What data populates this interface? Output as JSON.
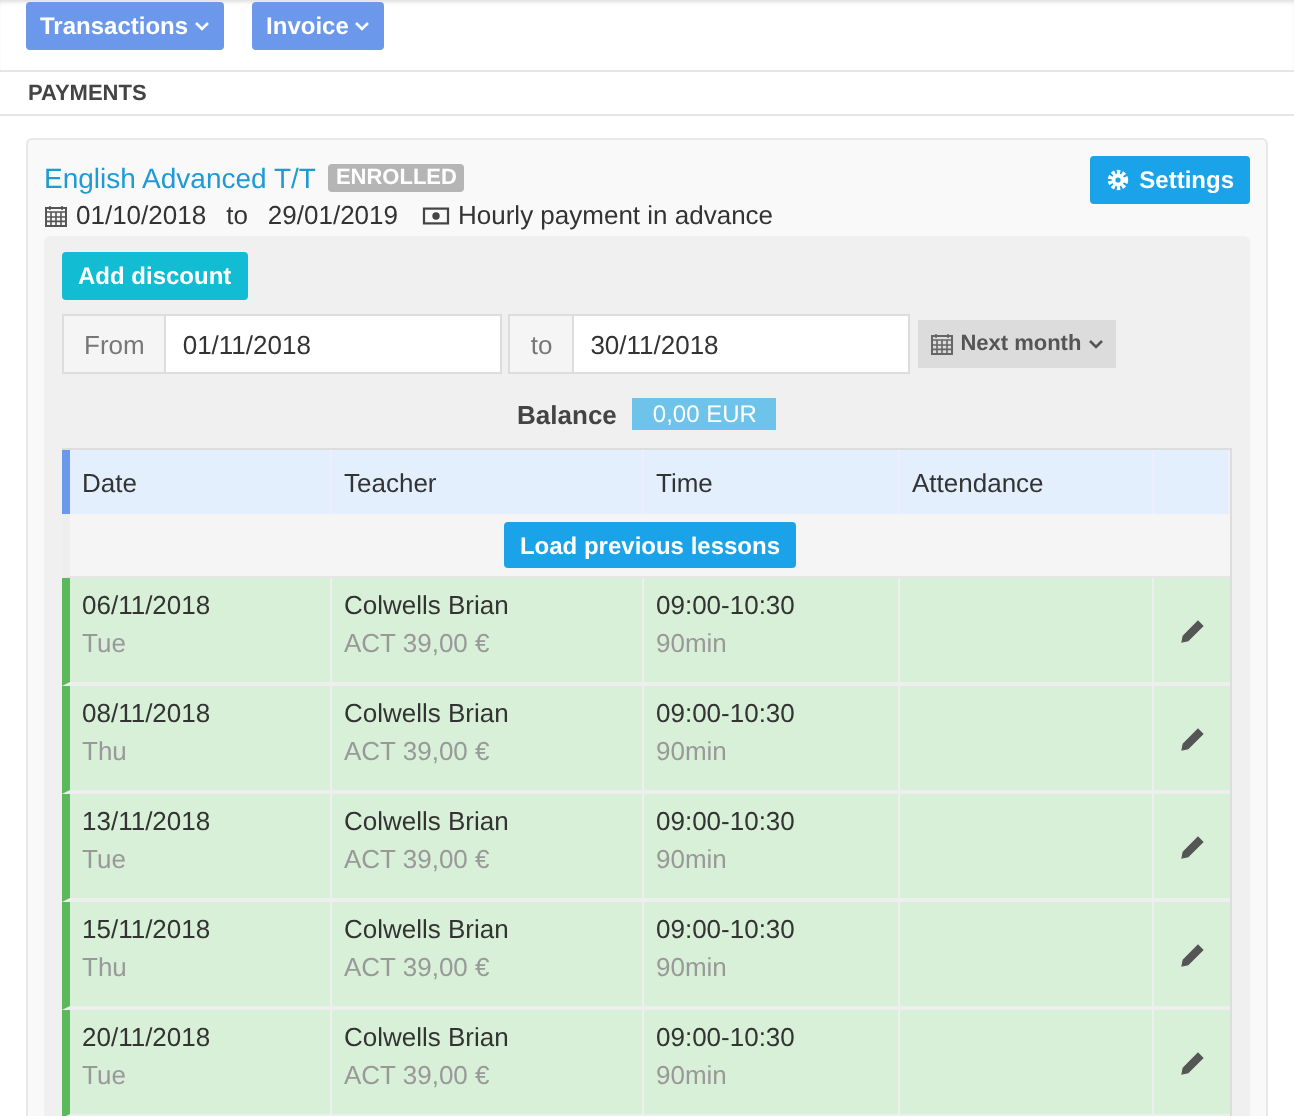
{
  "toolbar": {
    "buttons": [
      {
        "label": "Transactions"
      },
      {
        "label": "Invoice"
      }
    ]
  },
  "section_title": "PAYMENTS",
  "course": {
    "name": "English Advanced T/T",
    "badge": "ENROLLED",
    "start": "01/10/2018",
    "separator": "to",
    "end": "29/01/2019",
    "payment": "Hourly payment in advance",
    "settings_button": "Settings"
  },
  "add_discount_button": "Add discount",
  "range": {
    "from_label": "From",
    "from_value": "01/11/2018",
    "to_label": "to",
    "to_value": "30/11/2018",
    "preset_button": "Next month"
  },
  "balance": {
    "label": "Balance",
    "value": "0,00 EUR"
  },
  "table": {
    "columns": [
      "Date",
      "Teacher",
      "Time",
      "Attendance"
    ],
    "load_button": "Load previous lessons",
    "rows": [
      {
        "date": "06/11/2018",
        "day": "Tue",
        "teacher": "Colwells Brian",
        "price": "ACT 39,00 €",
        "time": "09:00-10:30",
        "duration": "90min"
      },
      {
        "date": "08/11/2018",
        "day": "Thu",
        "teacher": "Colwells Brian",
        "price": "ACT 39,00 €",
        "time": "09:00-10:30",
        "duration": "90min"
      },
      {
        "date": "13/11/2018",
        "day": "Tue",
        "teacher": "Colwells Brian",
        "price": "ACT 39,00 €",
        "time": "09:00-10:30",
        "duration": "90min"
      },
      {
        "date": "15/11/2018",
        "day": "Thu",
        "teacher": "Colwells Brian",
        "price": "ACT 39,00 €",
        "time": "09:00-10:30",
        "duration": "90min"
      },
      {
        "date": "20/11/2018",
        "day": "Tue",
        "teacher": "Colwells Brian",
        "price": "ACT 39,00 €",
        "time": "09:00-10:30",
        "duration": "90min"
      }
    ]
  }
}
